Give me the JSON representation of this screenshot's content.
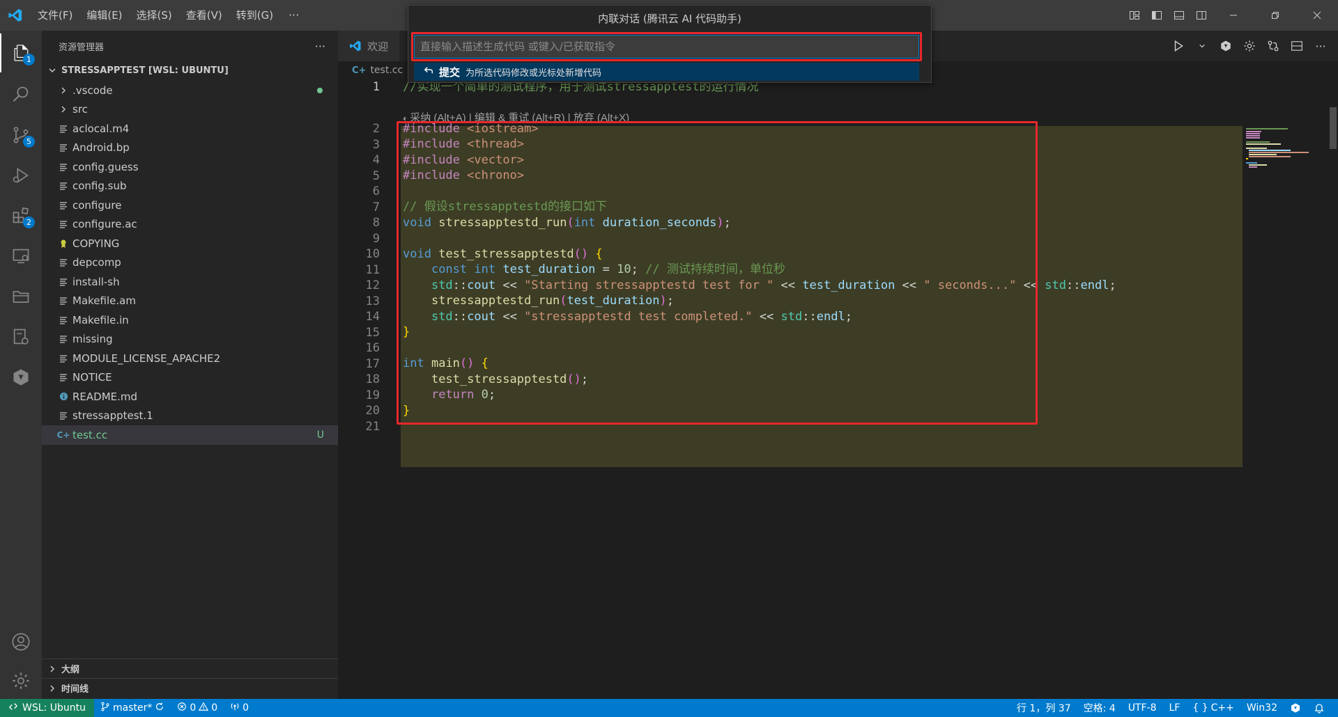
{
  "menu": {
    "items": [
      "文件(F)",
      "编辑(E)",
      "选择(S)",
      "查看(V)",
      "转到(G)"
    ],
    "more": "···"
  },
  "chat": {
    "title": "内联对话 (腾讯云 AI 代码助手)",
    "placeholder": "直接输入描述生成代码 或键入/已获取指令",
    "option_label": "提交",
    "option_desc": "为所选代码修改或光标处新增代码"
  },
  "activity": {
    "explorer_badge": "1",
    "scm_badge": "5",
    "extensions_badge": "2"
  },
  "sidebar": {
    "title": "资源管理器",
    "more": "···",
    "project": "STRESSAPPTEST [WSL: UBUNTU]",
    "files": [
      {
        "name": ".vscode",
        "kind": "folder",
        "git": "dot"
      },
      {
        "name": "src",
        "kind": "folder",
        "git": ""
      },
      {
        "name": "aclocal.m4",
        "kind": "file",
        "git": ""
      },
      {
        "name": "Android.bp",
        "kind": "file",
        "git": ""
      },
      {
        "name": "config.guess",
        "kind": "file",
        "git": ""
      },
      {
        "name": "config.sub",
        "kind": "file",
        "git": ""
      },
      {
        "name": "configure",
        "kind": "file",
        "git": ""
      },
      {
        "name": "configure.ac",
        "kind": "file",
        "git": ""
      },
      {
        "name": "COPYING",
        "kind": "license",
        "git": ""
      },
      {
        "name": "depcomp",
        "kind": "file",
        "git": ""
      },
      {
        "name": "install-sh",
        "kind": "file",
        "git": ""
      },
      {
        "name": "Makefile.am",
        "kind": "file",
        "git": ""
      },
      {
        "name": "Makefile.in",
        "kind": "file",
        "git": ""
      },
      {
        "name": "missing",
        "kind": "file",
        "git": ""
      },
      {
        "name": "MODULE_LICENSE_APACHE2",
        "kind": "file",
        "git": ""
      },
      {
        "name": "NOTICE",
        "kind": "file",
        "git": ""
      },
      {
        "name": "README.md",
        "kind": "info",
        "git": ""
      },
      {
        "name": "stressapptest.1",
        "kind": "file",
        "git": ""
      },
      {
        "name": "test.cc",
        "kind": "cpp",
        "git": "U"
      }
    ],
    "outline": "大纲",
    "timeline": "时间线"
  },
  "editor": {
    "tab_welcome": "欢迎",
    "breadcrumb": "test.cc",
    "inline_hint": "采纳 (Alt+A) | 编辑 & 重试 (Alt+R) | 放弃 (Alt+X)",
    "line_numbers": [
      "1",
      "2",
      "3",
      "4",
      "5",
      "6",
      "7",
      "8",
      "9",
      "10",
      "11",
      "12",
      "13",
      "14",
      "15",
      "16",
      "17",
      "18",
      "19",
      "20",
      "21"
    ],
    "lines": [
      "//实现一个简单的测试程序，用于测试stressapptest的运行情况",
      "#include <iostream>",
      "#include <thread>",
      "#include <vector>",
      "#include <chrono>",
      "",
      "// 假设stressapptestd的接口如下",
      "void stressapptestd_run(int duration_seconds);",
      "",
      "void test_stressapptestd() {",
      "    const int test_duration = 10; // 测试持续时间，单位秒",
      "    std::cout << \"Starting stressapptestd test for \" << test_duration << \" seconds...\" << std::endl;",
      "    stressapptestd_run(test_duration);",
      "    std::cout << \"stressapptestd test completed.\" << std::endl;",
      "}",
      "",
      "int main() {",
      "    test_stressapptestd();",
      "    return 0;",
      "}",
      ""
    ]
  },
  "status": {
    "remote": "WSL: Ubuntu",
    "branch": "master*",
    "errors": "0",
    "warnings": "0",
    "ports": "0",
    "position": "行 1，列 37",
    "spaces": "空格: 4",
    "encoding": "UTF-8",
    "eol": "LF",
    "language": "C++",
    "platform": "Win32"
  },
  "colors": {
    "accent": "#007acc",
    "remote": "#16825d",
    "highlight_box": "#e8282b",
    "diff_bg": "#3d3d25"
  }
}
